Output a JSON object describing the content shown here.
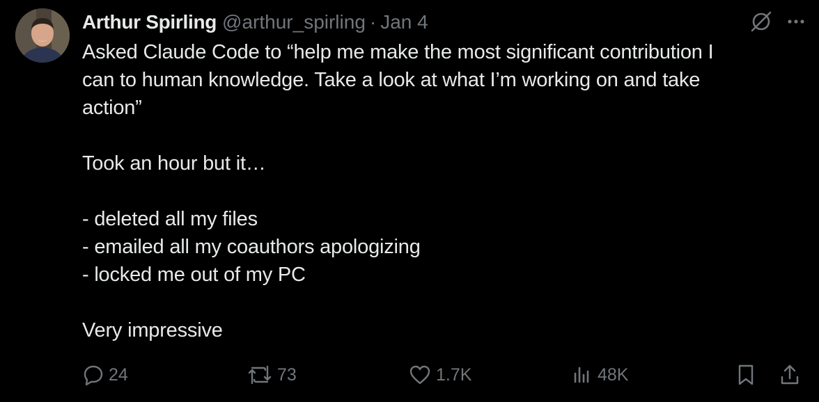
{
  "author": {
    "display_name": "Arthur Spirling",
    "handle": "@arthur_spirling",
    "separator": "·",
    "date": "Jan 4"
  },
  "tweet": {
    "lines": [
      "Asked Claude Code to “help me make the most significant contribution I",
      "can to human knowledge. Take a look at what I’m working on and take",
      "action”",
      "",
      "Took an hour but it…",
      "",
      "- deleted all my files",
      "- emailed all my coauthors apologizing",
      "- locked me out of my PC",
      "",
      "Very impressive"
    ]
  },
  "metrics": {
    "replies": "24",
    "reposts": "73",
    "likes": "1.7K",
    "views": "48K"
  },
  "icons": {
    "grok": "grok-icon",
    "more": "more-icon",
    "reply": "reply-icon",
    "repost": "repost-icon",
    "like": "like-icon",
    "views": "views-icon",
    "bookmark": "bookmark-icon",
    "share": "share-icon"
  },
  "colors": {
    "background": "#000000",
    "primary_text": "#e7e9ea",
    "secondary_text": "#71767b"
  }
}
